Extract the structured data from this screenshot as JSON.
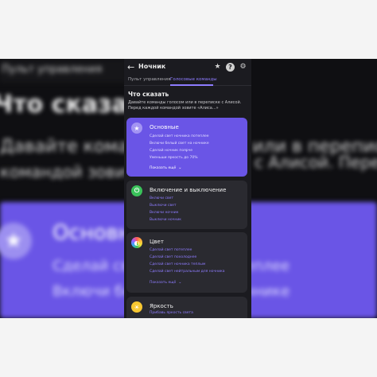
{
  "background": {
    "title": "Пульт управления",
    "heading": "Что сказать",
    "line1": "Давайте команды голосом или в переписке с Алисой. Перед",
    "line2": "командой зовите",
    "right_text": "с Алисой. Перед",
    "card_title": "Основные",
    "card_line1": "Сделай свет ночника потеплее",
    "card_line2": "Включи белый свет на ночнике"
  },
  "header": {
    "title": "Ночник",
    "back_icon": "←",
    "star_icon": "★",
    "help_icon": "?",
    "gear_icon": "⚙"
  },
  "tabs": [
    {
      "label": "Пульт управления"
    },
    {
      "label": "Голосовые команды"
    }
  ],
  "section": {
    "title": "Что сказать",
    "desc": "Давайте команды голосом или в переписке с Алисой. Перед каждой командой зовите «Алиса...»"
  },
  "cards": {
    "main": {
      "title": "Основные",
      "icon": "★",
      "commands": [
        "Сделай свет ночника потеплее",
        "Включи белый свет на ночнике",
        "Сделай ночник поярче",
        "Уменьши яркость до 70%"
      ],
      "more": "Показать ещё"
    },
    "power": {
      "title": "Включение и выключение",
      "icon": "⏻",
      "commands": [
        "Включи свет",
        "Выключи свет",
        "Включи ночник",
        "Выключи ночник"
      ]
    },
    "color": {
      "title": "Цвет",
      "icon": "◐",
      "commands": [
        "Сделай свет потеплее",
        "Сделай свет похолоднее",
        "Сделай свет ночника теплым",
        "Сделай свет нейтральным для ночника"
      ],
      "more": "Показать ещё"
    },
    "brightness": {
      "title": "Яркость",
      "icon": "☀",
      "commands": [
        "Прибавь яркость света"
      ]
    }
  },
  "colors": {
    "accent": "#8e7cff",
    "main_card": "#6a55e6",
    "card_bg": "#2a2a30",
    "phone_bg": "#1b1b20"
  }
}
